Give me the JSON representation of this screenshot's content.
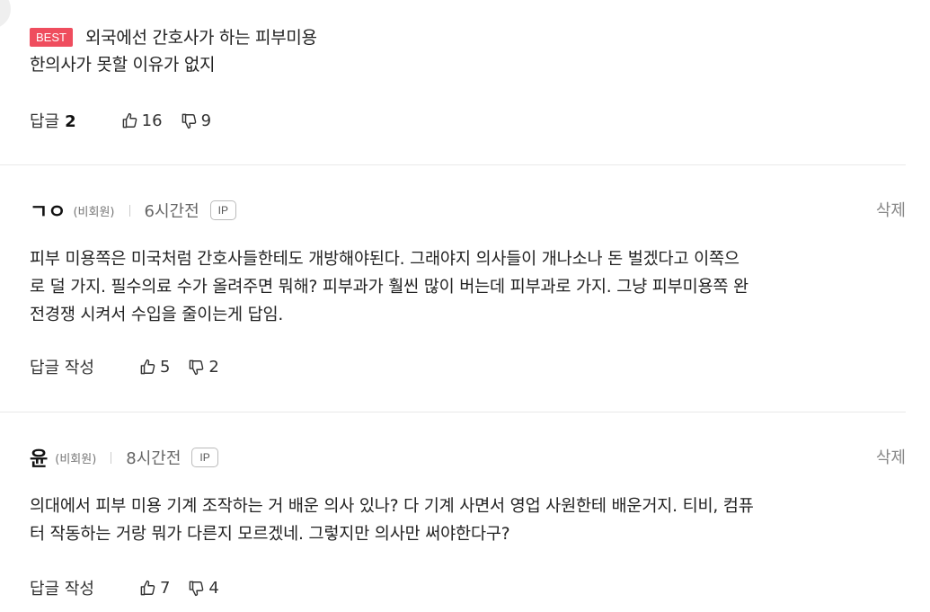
{
  "best_comment": {
    "badge": "BEST",
    "line1": "외국에선 간호사가 하는 피부미용",
    "line2": "한의사가 못할 이유가 없지",
    "reply_label": "답글",
    "reply_count": "2",
    "likes": "16",
    "dislikes": "9"
  },
  "comments": [
    {
      "author": "ㄱㅇ",
      "member_type": "(비회원)",
      "time": "6시간전",
      "ip_label": "IP",
      "delete_label": "삭제",
      "lines": [
        "피부 미용쪽은 미국처럼 간호사들한테도 개방해야된다. 그래야지 의사들이 개나소나 돈 벌겠다고 이쪽으",
        "로 덜 가지. 필수의료 수가 올려주면 뭐해? 피부과가 훨씬 많이 버는데 피부과로 가지. 그냥 피부미용쪽 완",
        "전경쟁 시켜서 수입을 줄이는게 답임."
      ],
      "reply_label": "답글 작성",
      "likes": "5",
      "dislikes": "2"
    },
    {
      "author": "윤",
      "member_type": "(비회원)",
      "time": "8시간전",
      "ip_label": "IP",
      "delete_label": "삭제",
      "lines": [
        "의대에서 피부 미용 기계 조작하는 거 배운 의사 있나? 다 기계 사면서 영업 사원한테 배운거지. 티비, 컴퓨",
        "터 작동하는 거랑 뭐가 다른지 모르겠네. 그렇지만 의사만 써야한다구?"
      ],
      "reply_label": "답글 작성",
      "likes": "7",
      "dislikes": "4"
    }
  ],
  "icons": {
    "like": "thumbs-up-outline",
    "dislike": "thumbs-down-outline"
  }
}
